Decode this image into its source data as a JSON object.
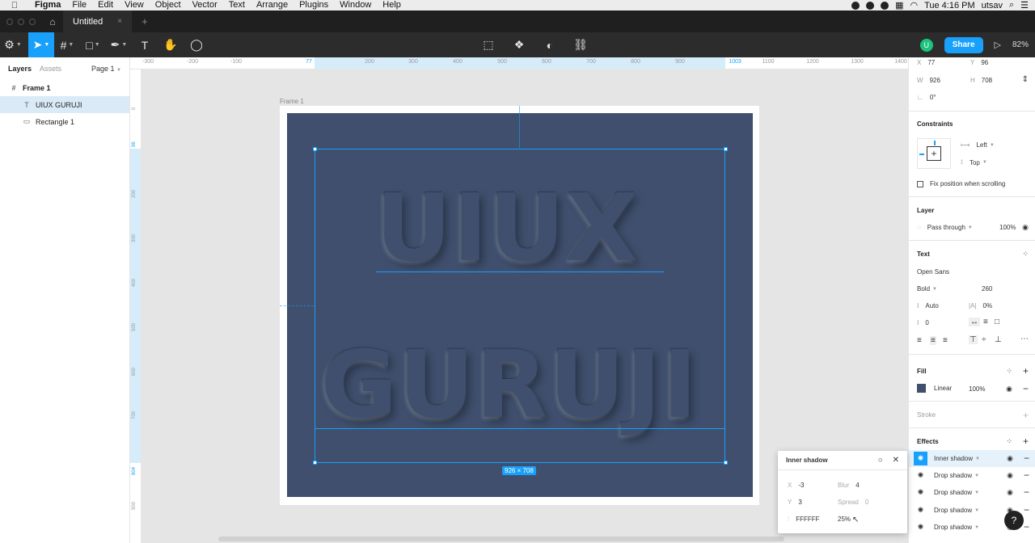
{
  "menubar": {
    "apple": "",
    "items": [
      "Figma",
      "File",
      "Edit",
      "View",
      "Object",
      "Vector",
      "Text",
      "Arrange",
      "Plugins",
      "Window",
      "Help"
    ],
    "clock": "Tue 4:16 PM",
    "user": "utsav"
  },
  "tabbar": {
    "doc_title": "Untitled",
    "close": "×",
    "new_tab": "+"
  },
  "toolbar": {
    "avatar_initial": "U",
    "share_label": "Share",
    "zoom": "82%"
  },
  "left_panel": {
    "tab_layers": "Layers",
    "tab_assets": "Assets",
    "page": "Page 1",
    "layers": [
      {
        "name": "Frame 1",
        "icon": "frame-icon"
      },
      {
        "name": "UIUX GURUJI",
        "icon": "text-icon"
      },
      {
        "name": "Rectangle 1",
        "icon": "rectangle-icon"
      }
    ]
  },
  "rulers": {
    "top_ticks": [
      "-300",
      "-200",
      "-100",
      "77",
      "200",
      "300",
      "400",
      "500",
      "600",
      "700",
      "800",
      "900",
      "1003",
      "1100",
      "1200",
      "1300",
      "1400"
    ],
    "left_ticks": [
      "0",
      "96",
      "200",
      "300",
      "400",
      "500",
      "600",
      "700",
      "804",
      "900"
    ]
  },
  "canvas": {
    "frame_label": "Frame 1",
    "text_line1": "UIUX",
    "text_line2": "GURUJI",
    "dimension_badge": "926 × 708"
  },
  "design_panel": {
    "x_label": "X",
    "x_value": "77",
    "y_label": "Y",
    "y_value": "96",
    "w_label": "W",
    "w_value": "926",
    "h_label": "H",
    "h_value": "708",
    "rotation": "0°",
    "constraints_title": "Constraints",
    "constraint_h": "Left",
    "constraint_v": "Top",
    "fix_position": "Fix position when scrolling",
    "layer_title": "Layer",
    "blend_mode": "Pass through",
    "layer_opacity": "100%",
    "text_title": "Text",
    "font_family": "Open Sans",
    "font_weight": "Bold",
    "font_size": "260",
    "line_height": "Auto",
    "letter_spacing": "0%",
    "paragraph_spacing": "0",
    "fill_title": "Fill",
    "fill_type": "Linear",
    "fill_opacity": "100%",
    "fill_color": "#3f4f6d",
    "stroke_title": "Stroke",
    "effects_title": "Effects",
    "effects": [
      "Inner shadow",
      "Drop shadow",
      "Drop shadow",
      "Drop shadow",
      "Drop shadow"
    ]
  },
  "effect_popup": {
    "title": "Inner shadow",
    "x_label": "X",
    "x_value": "-3",
    "y_label": "Y",
    "y_value": "3",
    "blur_label": "Blur",
    "blur_value": "4",
    "spread_label": "Spread",
    "spread_value": "0",
    "color": "FFFFFF",
    "opacity": "25%"
  },
  "help": "?"
}
